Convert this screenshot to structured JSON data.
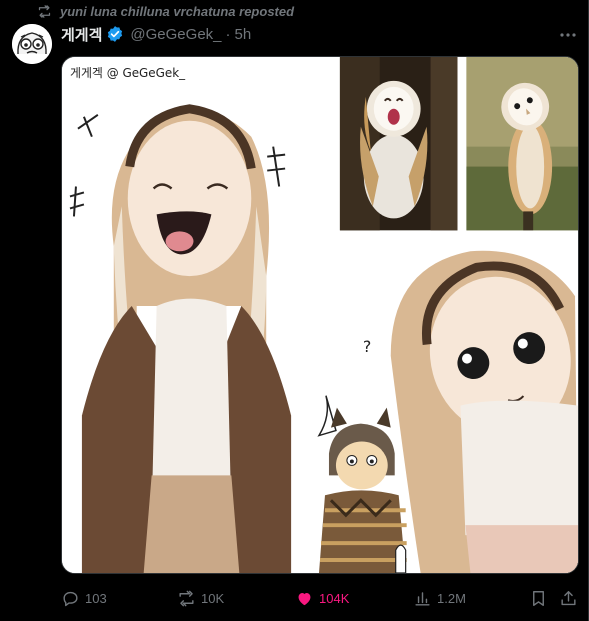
{
  "repost": {
    "text": "yuni luna chilluna vrchatuna reposted",
    "icon": "repost-icon"
  },
  "author": {
    "display_name": "게게겍",
    "handle": "@GeGeGek_",
    "separator": "·",
    "time": "5h",
    "verified": true,
    "avatar_icon": "cartoon-face-avatar"
  },
  "media": {
    "signature_text": "게게겍 @ GeGeGek_",
    "question_mark": "?",
    "icon": "comic-illustration"
  },
  "actions": {
    "replies": "103",
    "reposts": "10K",
    "likes": "104K",
    "views": "1.2M"
  },
  "colors": {
    "background": "#000000",
    "text_primary": "#e7e9ea",
    "text_secondary": "#71767b",
    "like": "#f91880",
    "verified": "#1d9bf0"
  }
}
